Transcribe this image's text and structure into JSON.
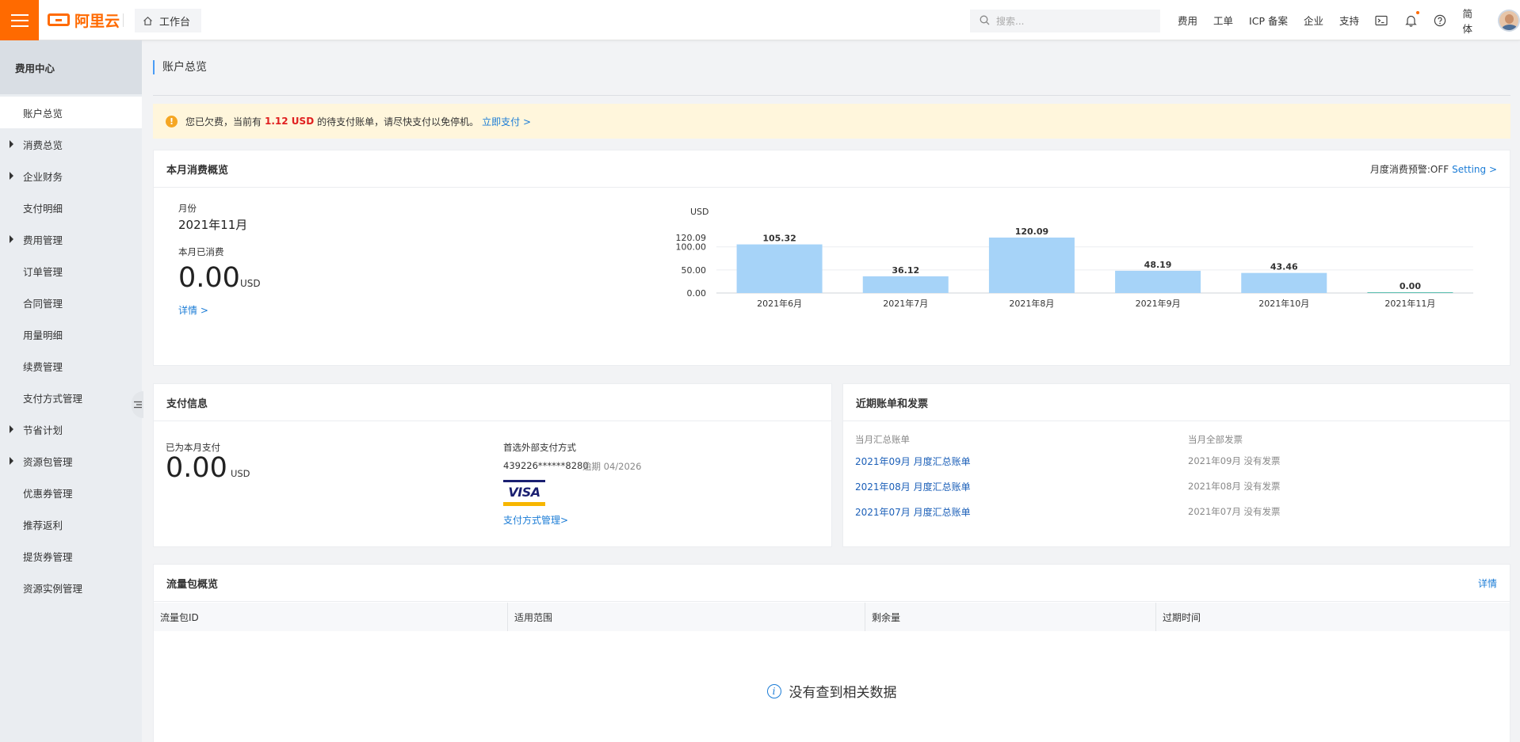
{
  "header": {
    "logo_text": "阿里云",
    "workbench_label": "工作台",
    "search_placeholder": "搜索...",
    "nav": [
      "费用",
      "工单",
      "ICP 备案",
      "企业",
      "支持"
    ],
    "language": "简体"
  },
  "sidebar": {
    "title": "费用中心",
    "items": [
      {
        "label": "账户总览",
        "expandable": false,
        "active": true
      },
      {
        "label": "消费总览",
        "expandable": true,
        "active": false
      },
      {
        "label": "企业财务",
        "expandable": true,
        "active": false
      },
      {
        "label": "支付明细",
        "expandable": false,
        "active": false
      },
      {
        "label": "费用管理",
        "expandable": true,
        "active": false
      },
      {
        "label": "订单管理",
        "expandable": false,
        "active": false
      },
      {
        "label": "合同管理",
        "expandable": false,
        "active": false
      },
      {
        "label": "用量明细",
        "expandable": false,
        "active": false
      },
      {
        "label": "续费管理",
        "expandable": false,
        "active": false
      },
      {
        "label": "支付方式管理",
        "expandable": false,
        "active": false
      },
      {
        "label": "节省计划",
        "expandable": true,
        "active": false
      },
      {
        "label": "资源包管理",
        "expandable": true,
        "active": false
      },
      {
        "label": "优惠券管理",
        "expandable": false,
        "active": false
      },
      {
        "label": "推荐返利",
        "expandable": false,
        "active": false
      },
      {
        "label": "提货券管理",
        "expandable": false,
        "active": false
      },
      {
        "label": "资源实例管理",
        "expandable": false,
        "active": false
      }
    ]
  },
  "page": {
    "title": "账户总览"
  },
  "alert": {
    "prefix": "您已欠费，当前有",
    "amount": "1.12 USD",
    "suffix": "的待支付账单，请尽快支付以免停机。",
    "link": "立即支付 >"
  },
  "monthly": {
    "title": "本月消费概览",
    "alarm_label": "月度消费预警:OFF",
    "setting_link": "Setting >",
    "month_label": "月份",
    "month_value": "2021年11月",
    "spent_label": "本月已消费",
    "spent_value": "0.00",
    "spent_unit": "USD",
    "detail_link": "详情 >"
  },
  "chart_data": {
    "type": "bar",
    "ylabel": "USD",
    "categories": [
      "2021年6月",
      "2021年7月",
      "2021年8月",
      "2021年9月",
      "2021年10月",
      "2021年11月"
    ],
    "values": [
      105.32,
      36.12,
      120.09,
      48.19,
      43.46,
      0.0
    ],
    "value_labels": [
      "105.32",
      "36.12",
      "120.09",
      "48.19",
      "43.46",
      "0.00"
    ],
    "yticks": [
      0,
      50,
      100,
      120.09
    ],
    "ytick_labels": [
      "0.00",
      "50.00",
      "100.00",
      "120.09"
    ],
    "ylim": [
      0,
      120.09
    ],
    "grid": true,
    "bar_color": "#a6d3f8",
    "zero_bar_color": "#5bbfb0"
  },
  "payment": {
    "title": "支付信息",
    "paid_label": "已为本月支付",
    "paid_value": "0.00",
    "paid_unit": "USD",
    "method_label": "首选外部支付方式",
    "card_number": "439226******8280",
    "expiry": "逾期 04/2026",
    "card_brand": "VISA",
    "manage_link": "支付方式管理>"
  },
  "bills": {
    "title": "近期账单和发票",
    "col_bills": "当月汇总账单",
    "col_invoices": "当月全部发票",
    "rows": [
      {
        "bill": "2021年09月 月度汇总账单",
        "invoice": "2021年09月 没有发票"
      },
      {
        "bill": "2021年08月 月度汇总账单",
        "invoice": "2021年08月 没有发票"
      },
      {
        "bill": "2021年07月 月度汇总账单",
        "invoice": "2021年07月 没有发票"
      }
    ]
  },
  "traffic": {
    "title": "流量包概览",
    "detail_link": "详情",
    "columns": [
      "流量包ID",
      "适用范围",
      "剩余量",
      "过期时间"
    ],
    "empty_text": "没有查到相关数据"
  },
  "colors": {
    "brand": "#ff6a00",
    "link": "#1b7cd6",
    "alert_bg": "#fff6dc",
    "danger": "#e02020"
  }
}
